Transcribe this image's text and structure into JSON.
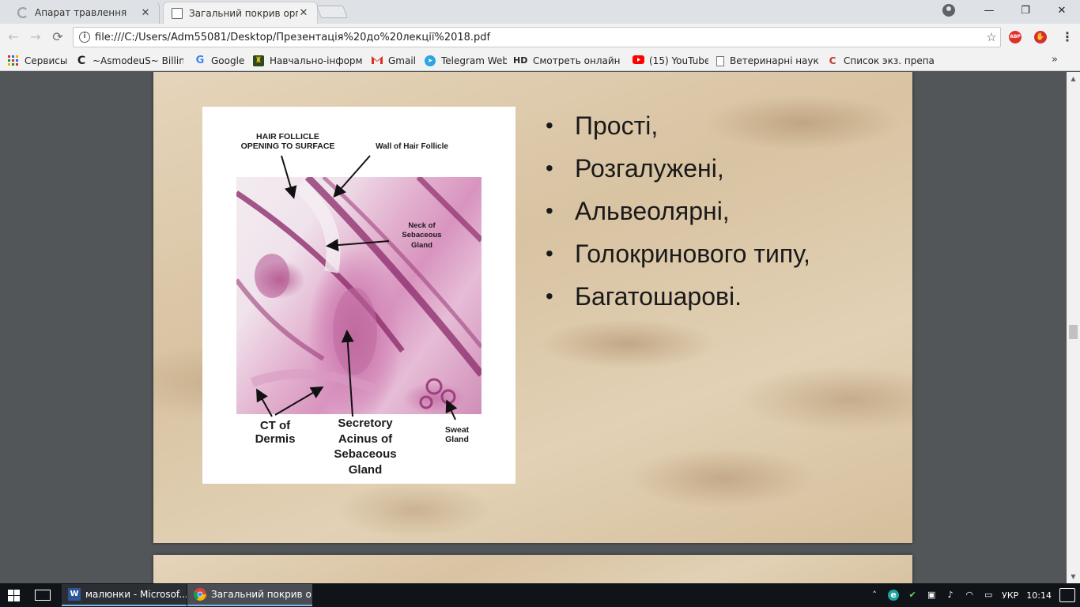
{
  "browser": {
    "tabs": [
      {
        "title": "Апарат травлення",
        "active": false,
        "icon": "loading-spinner-icon"
      },
      {
        "title": "Загальний покрив орга",
        "active": true,
        "icon": "document-icon"
      }
    ],
    "window_controls": {
      "minimize": "—",
      "restore": "❐",
      "close": "✕"
    },
    "address_bar": {
      "url": "file:///C:/Users/Adm55081/Desktop/Презентація%20до%20лекції%2018.pdf"
    },
    "extensions": [
      {
        "name": "adblock-plus-icon",
        "label": "ABP"
      },
      {
        "name": "stop-hand-icon",
        "label": "✋"
      }
    ],
    "bookmarks": [
      {
        "label": "Сервисы",
        "icon": "apps-grid-icon"
      },
      {
        "label": "~AsmodeuS~ Billing",
        "icon": "c-logo-icon"
      },
      {
        "label": "Google",
        "icon": "google-icon"
      },
      {
        "label": "Навчально-інформа",
        "icon": "university-crest-icon"
      },
      {
        "label": "Gmail",
        "icon": "gmail-icon"
      },
      {
        "label": "Telegram Web",
        "icon": "telegram-icon"
      },
      {
        "label": "Смотреть онлайн фі",
        "icon": "hd-icon",
        "icon_text": "HD"
      },
      {
        "label": "(15) YouTube",
        "icon": "youtube-icon"
      },
      {
        "label": "Ветеринарні науки",
        "icon": "page-icon"
      },
      {
        "label": "Список экз. препара",
        "icon": "bookmark-site-icon"
      }
    ],
    "bookmarks_overflow": "»"
  },
  "slide": {
    "figure_labels": {
      "hair_follicle": "HAIR FOLLICLE\nOPENING TO SURFACE",
      "wall": "Wall of Hair Follicle",
      "neck": "Neck of\nSebaceous\nGland",
      "ct": "CT of\nDermis",
      "secretory": "Secretory\nAcinus of\nSebaceous\nGland",
      "sweat": "Sweat\nGland"
    },
    "bullets": [
      "Прості,",
      "Розгалужені,",
      "Альвеолярні,",
      "Голокринового типу,",
      "Багатошарові."
    ]
  },
  "taskbar": {
    "tasks": [
      {
        "label": "малюнки - Microsof...",
        "icon": "word-icon"
      },
      {
        "label": "Загальний покрив о...",
        "icon": "chrome-icon"
      }
    ],
    "tray": {
      "language": "УКР",
      "time": "10:14"
    }
  }
}
